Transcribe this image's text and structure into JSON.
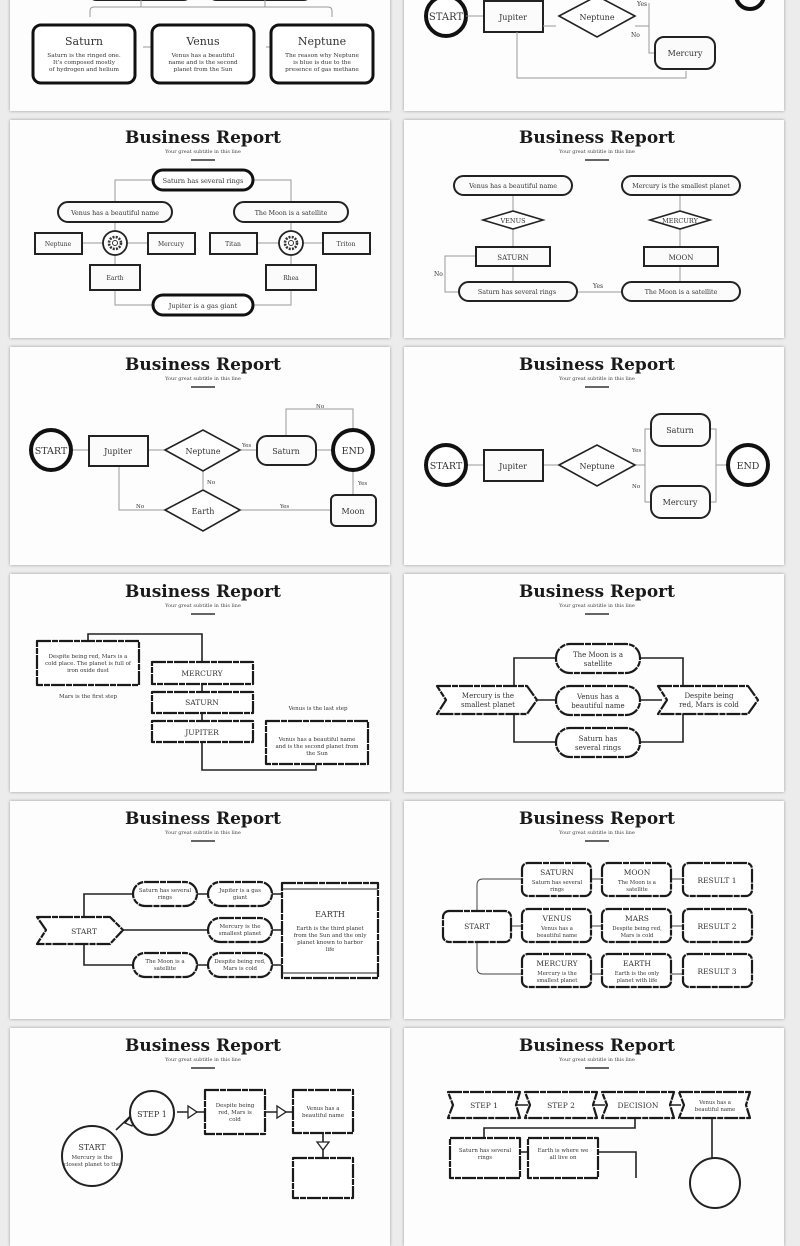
{
  "deck": {
    "title": "Business Report",
    "subtitle": "Your great subtitle in this line"
  },
  "slides": [
    {
      "id": "planets-cards",
      "cards": [
        {
          "title": "Saturn",
          "text": [
            "Saturn is the ringed one.",
            "It’s composed mostly",
            "of hydrogen and helium"
          ]
        },
        {
          "title": "Venus",
          "text": [
            "Venus has a beautiful",
            "name and is the second",
            "planet from the Sun"
          ]
        },
        {
          "title": "Neptune",
          "text": [
            "The reason why Neptune",
            "is blue is due to the",
            "presence of gas methane"
          ]
        }
      ]
    },
    {
      "id": "decision-partial",
      "start": "START",
      "process": "Jupiter",
      "decision": "Neptune",
      "no_label": "No",
      "yes_label": "Yes",
      "result": "Mercury"
    },
    {
      "id": "tree-gears",
      "top": "Saturn has several rings",
      "left_branch": "Venus has a beautiful name",
      "right_branch": "The Moon is a satellite",
      "left_nodes": [
        "Neptune",
        "Mercury",
        "Earth"
      ],
      "right_nodes": [
        "Titan",
        "Triton",
        "Rhea"
      ],
      "bottom": "Jupiter is a gas giant",
      "icon": "gear-icon"
    },
    {
      "id": "two-column-decision",
      "left": {
        "top": "Venus has a beautiful name",
        "decision": "VENUS",
        "process": "SATURN",
        "bottom": "Saturn has several rings"
      },
      "right": {
        "top": "Mercury is the smallest planet",
        "decision": "MERCURY",
        "process": "MOON",
        "bottom": "The Moon is a satellite"
      },
      "no_label": "No",
      "yes_label": "Yes"
    },
    {
      "id": "loop-flow",
      "start": "START",
      "process": "Jupiter",
      "decision1": "Neptune",
      "decision2": "Earth",
      "yes_node": "Saturn",
      "end": "END",
      "side_node": "Moon",
      "labels": {
        "top_no": "No",
        "yes1": "Yes",
        "no_mid": "No",
        "no_left": "No",
        "yes_bottom": "Yes",
        "yes_right": "Yes"
      }
    },
    {
      "id": "branch-flow",
      "start": "START",
      "process": "Jupiter",
      "decision": "Neptune",
      "yes_node": "Saturn",
      "no_node": "Mercury",
      "end": "END",
      "yes_label": "Yes",
      "no_label": "No"
    },
    {
      "id": "steps-sketch",
      "mars_text": [
        "Despite being red, Mars is a",
        "cold place. The planet is full of",
        "iron oxide dust"
      ],
      "mars_caption": "Mars is the first step",
      "steps": [
        "MERCURY",
        "SATURN",
        "JUPITER"
      ],
      "venus_caption": "Venus is the last step",
      "venus_text": [
        "Venus has a beautiful name",
        "and is the second planet from",
        "the Sun"
      ]
    },
    {
      "id": "parallel-sketch",
      "left": [
        "Mercury is the",
        "smallest planet"
      ],
      "middle": [
        [
          "The Moon is a",
          "satellite"
        ],
        [
          "Venus has a",
          "beautiful name"
        ],
        [
          "Saturn has",
          "several rings"
        ]
      ],
      "right": [
        "Despite being",
        "red, Mars is cold"
      ]
    },
    {
      "id": "earth-sketch",
      "start": "START",
      "pills": [
        [
          "Saturn has several",
          "rings"
        ],
        [
          "Jupiter is a gas",
          "giant"
        ],
        [
          "Mercury is the",
          "smallest planet"
        ],
        [
          "The Moon is a",
          "satellite"
        ],
        [
          "Despite being red,",
          "Mars is cold"
        ]
      ],
      "earth_title": "EARTH",
      "earth_text": [
        "Earth is the third planet",
        "from the Sun and the only",
        "planet known to harbor",
        "life"
      ]
    },
    {
      "id": "results-grid",
      "start": "START",
      "rows": [
        {
          "a_title": "SATURN",
          "a_text": [
            "Saturn has several",
            "rings"
          ],
          "b_title": "MOON",
          "b_text": [
            "The Moon is a",
            "satellite"
          ],
          "result": "RESULT 1"
        },
        {
          "a_title": "VENUS",
          "a_text": [
            "Venus has a",
            "beautiful name"
          ],
          "b_title": "MARS",
          "b_text": [
            "Despite being red,",
            "Mars is cold"
          ],
          "result": "RESULT 2"
        },
        {
          "a_title": "MERCURY",
          "a_text": [
            "Mercury is the",
            "smallest planet"
          ],
          "b_title": "EARTH",
          "b_text": [
            "Earth is the only",
            "planet with life"
          ],
          "result": "RESULT 3"
        }
      ]
    },
    {
      "id": "circle-steps",
      "start_title": "START",
      "start_text": [
        "Mercury is the",
        "closest planet to the"
      ],
      "step": "STEP 1",
      "box1": [
        "Despite being",
        "red, Mars is",
        "cold"
      ],
      "box2": [
        "Venus has a",
        "beautiful name"
      ]
    },
    {
      "id": "ribbon-steps",
      "ribbons": [
        "STEP 1",
        "STEP 2",
        "DECISION"
      ],
      "ribbon_note": [
        "Venus has a",
        "beautiful name"
      ],
      "boxes": [
        [
          "Saturn has several",
          "rings"
        ],
        [
          "Earth is where we",
          "all live on"
        ]
      ]
    }
  ]
}
